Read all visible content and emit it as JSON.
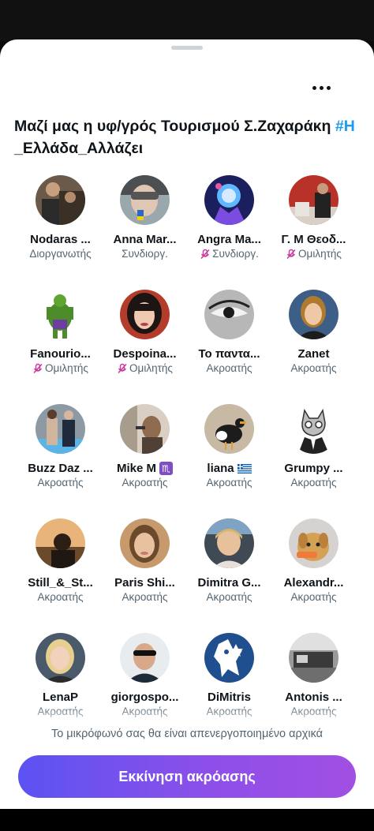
{
  "space": {
    "title_main": "Μαζί μας η υφ/γρός Τουρισμού Σ.Ζαχαράκη ",
    "title_hashtag": "#Η",
    "title_rest": " _Ελλάδα_Αλλάζει"
  },
  "people": [
    {
      "name": "Nodaras ...",
      "role": "Διοργανωτής",
      "muted": false
    },
    {
      "name": "Anna Mar...",
      "role": "Συνδιοργ.",
      "muted": false
    },
    {
      "name": "Angra Ma...",
      "role": "Συνδιοργ.",
      "muted": true
    },
    {
      "name": "Γ. Μ Θεοδ...",
      "role": "Ομιλητής",
      "muted": true
    },
    {
      "name": "Fanourio...",
      "role": "Ομιλητής",
      "muted": true
    },
    {
      "name": "Despoina...",
      "role": "Ομιλητής",
      "muted": true
    },
    {
      "name": "Το παντα...",
      "role": "Ακροατής",
      "muted": false
    },
    {
      "name": "Zanet",
      "role": "Ακροατής",
      "muted": false
    },
    {
      "name": "Buzz Daz ...",
      "role": "Ακροατής",
      "muted": false
    },
    {
      "name": "Mike M",
      "role": "Ακροατής",
      "muted": false,
      "badge": "♏"
    },
    {
      "name": "liana",
      "role": "Ακροατής",
      "muted": false,
      "flag": "greece"
    },
    {
      "name": "Grumpy ...",
      "role": "Ακροατής",
      "muted": false
    },
    {
      "name": "Still_&_St...",
      "role": "Ακροατής",
      "muted": false
    },
    {
      "name": "Paris Shi...",
      "role": "Ακροατής",
      "muted": false
    },
    {
      "name": "Dimitra G...",
      "role": "Ακροατής",
      "muted": false
    },
    {
      "name": "Alexandr...",
      "role": "Ακροατής",
      "muted": false
    },
    {
      "name": "LenaP",
      "role": "Ακροατής",
      "muted": false
    },
    {
      "name": "giorgospo...",
      "role": "Ακροατής",
      "muted": false
    },
    {
      "name": "DiMitris",
      "role": "Ακροατής",
      "muted": false
    },
    {
      "name": "Antonis ...",
      "role": "Ακροατής",
      "muted": false
    }
  ],
  "notice": "Το μικρόφωνό σας θα είναι απενεργοποιημένο αρχικά",
  "start_button": "Εκκίνηση ακρόασης",
  "colors": {
    "accent_blue": "#1d9bf0",
    "button_gradient_start": "#5b53f2",
    "button_gradient_end": "#a24fe3",
    "muted_icon": "#c9379d"
  },
  "icons": {
    "more": "more-dots-icon",
    "muted": "mic-off-icon"
  }
}
